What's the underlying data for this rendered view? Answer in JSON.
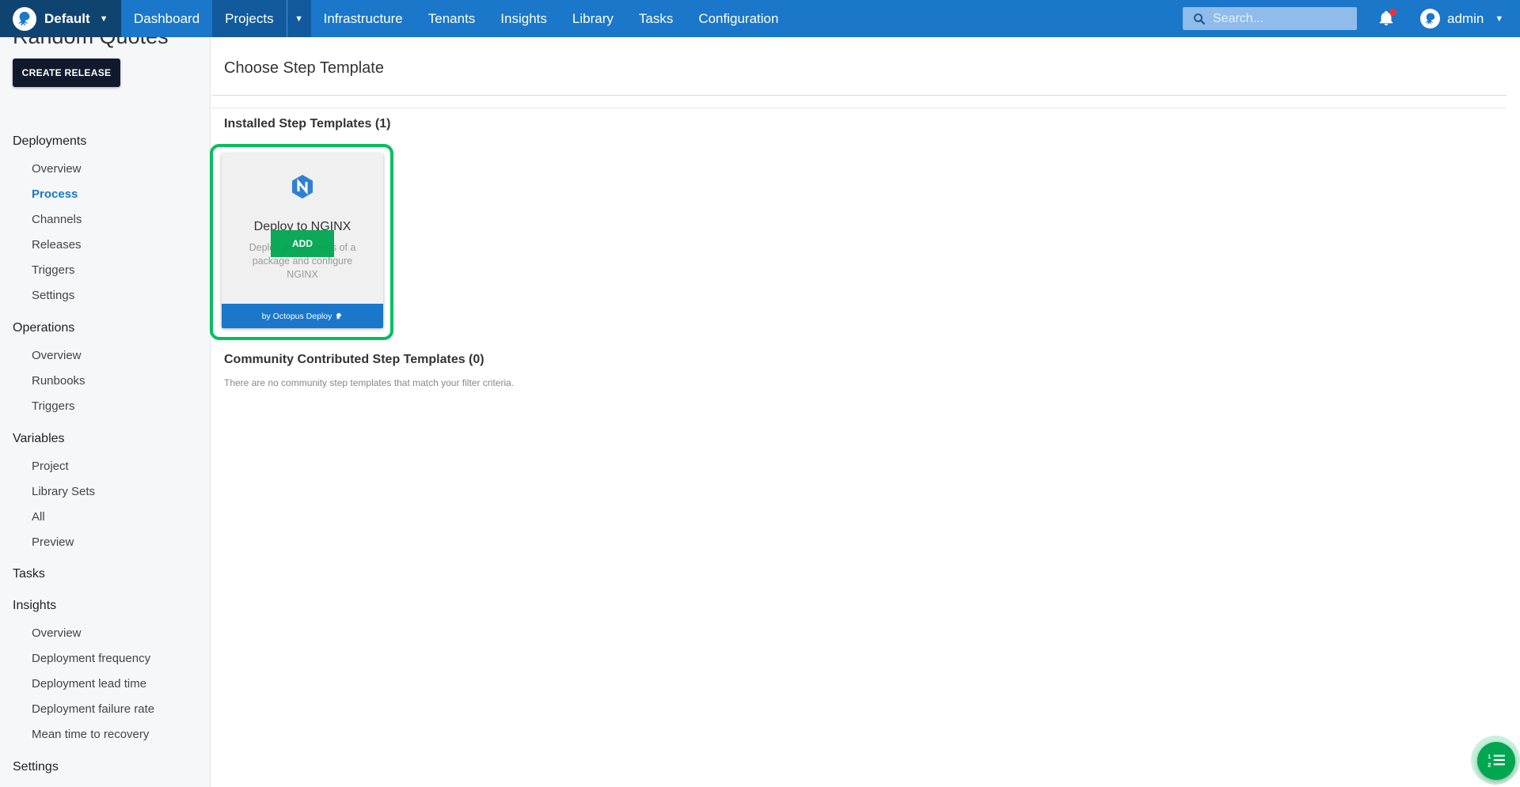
{
  "topbar": {
    "space_name": "Default",
    "nav": [
      "Dashboard",
      "Projects",
      "Infrastructure",
      "Tenants",
      "Insights",
      "Library",
      "Tasks",
      "Configuration"
    ],
    "search_placeholder": "Search...",
    "user_name": "admin",
    "brand_color": "#1a77ca"
  },
  "sidebar": {
    "project_title": "Random Quotes",
    "create_release_label": "CREATE RELEASE",
    "deployments": {
      "label": "Deployments",
      "items": [
        "Overview",
        "Process",
        "Channels",
        "Releases",
        "Triggers",
        "Settings"
      ],
      "active": "Process"
    },
    "operations": {
      "label": "Operations",
      "items": [
        "Overview",
        "Runbooks",
        "Triggers"
      ]
    },
    "variables": {
      "label": "Variables",
      "items": [
        "Project",
        "Library Sets",
        "All",
        "Preview"
      ]
    },
    "tasks": {
      "label": "Tasks"
    },
    "insights": {
      "label": "Insights",
      "items": [
        "Overview",
        "Deployment frequency",
        "Deployment lead time",
        "Deployment failure rate",
        "Mean time to recovery"
      ]
    },
    "settings": {
      "label": "Settings"
    }
  },
  "main": {
    "title": "Choose Step Template",
    "installed_title": "Installed Step Templates (1)",
    "template": {
      "name": "Deploy to NGINX",
      "description": "Deploy the contents of a package and configure NGINX",
      "add_label": "ADD",
      "author": "by Octopus Deploy"
    },
    "community_title": "Community Contributed Step Templates (0)",
    "community_empty": "There are no community step templates that match your filter criteria."
  }
}
